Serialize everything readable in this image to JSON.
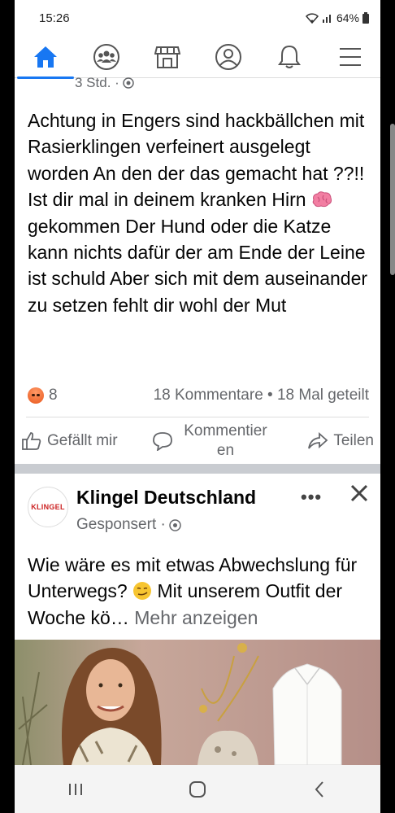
{
  "status_bar": {
    "time": "15:26",
    "battery": "64%"
  },
  "nav": {
    "items": [
      {
        "name": "home",
        "icon": "home-icon",
        "active": true
      },
      {
        "name": "groups",
        "icon": "groups-icon"
      },
      {
        "name": "marketplace",
        "icon": "marketplace-icon"
      },
      {
        "name": "profile",
        "icon": "profile-icon"
      },
      {
        "name": "notifications",
        "icon": "bell-icon"
      },
      {
        "name": "menu",
        "icon": "menu-icon"
      }
    ],
    "accent": "#1877f2"
  },
  "post1": {
    "time": "3 Std. ·",
    "text_before_emoji": "Achtung in Engers sind hackbällchen mit Rasierklingen verfeinert ausgelegt worden  An den der das gemacht hat ??!! Ist dir mal in deinem kranken Hirn ",
    "emoji": "brain-emoji",
    "text_after_emoji": " gekommen Der Hund oder die Katze kann nichts dafür der am Ende der Leine ist schuld Aber sich mit dem auseinander zu setzen fehlt dir wohl der Mut",
    "reaction_count": "8",
    "comments": "18 Kommentare",
    "shares": "18 Mal geteilt",
    "stats_separator": " • ",
    "actions": {
      "like": "Gefällt mir",
      "comment_line1": "Kommentier",
      "comment_line2": "en",
      "share": "Teilen"
    }
  },
  "post2": {
    "avatar_text": "KLINGEL",
    "page_name": "Klingel Deutschland",
    "sponsored": "Gesponsert ·",
    "text": "Wie wäre es mit etwas Abwechslung für Unterwegs? ",
    "emoji": "smirk-emoji",
    "text_after_emoji": " Mit unserem Outfit der Woche kö… ",
    "more_link": "Mehr anzeigen",
    "more_icon": "•••"
  },
  "colors": {
    "text": "#050505",
    "secondary": "#65676b",
    "separator": "#c9ccd1",
    "ad_bg": "#b58f88"
  }
}
